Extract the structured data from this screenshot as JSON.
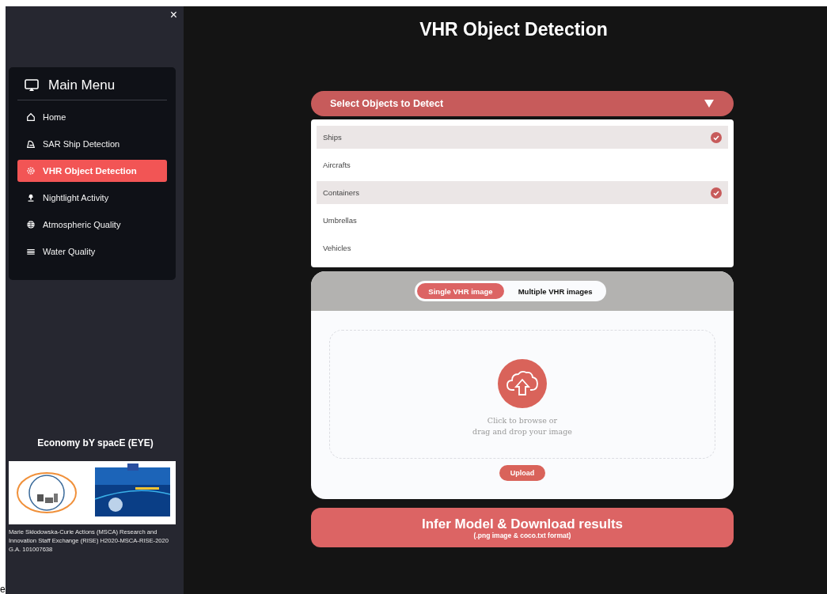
{
  "sidebar": {
    "close": "×",
    "menu_title": "Main Menu",
    "items": [
      {
        "label": "Home",
        "selected": false
      },
      {
        "label": "SAR Ship Detection",
        "selected": false
      },
      {
        "label": "VHR Object Detection",
        "selected": true
      },
      {
        "label": "Nightlight Activity",
        "selected": false
      },
      {
        "label": "Atmospheric Quality",
        "selected": false
      },
      {
        "label": "Water Quality",
        "selected": false
      }
    ],
    "project_title": "Economy bY spacE (EYE)",
    "caption": "Marie Skłodowska-Curie Actions (MSCA) Research and Innovation Staff Exchange (RISE) H2020-MSCA-RISE-2020 G.A. 101007638",
    "stray_text": "e"
  },
  "page_title": "VHR Object Detection",
  "object_select": {
    "label": "Select Objects to Detect",
    "expanded": true,
    "options": [
      {
        "label": "Ships",
        "selected": true
      },
      {
        "label": "Aircrafts",
        "selected": false
      },
      {
        "label": "Containers",
        "selected": true
      },
      {
        "label": "Umbrellas",
        "selected": false
      },
      {
        "label": "Vehicles",
        "selected": false
      }
    ]
  },
  "upload": {
    "tabs": [
      {
        "label": "Single VHR image",
        "selected": true
      },
      {
        "label": "Multiple VHR images",
        "selected": false
      }
    ],
    "hint": [
      "Click to browse or",
      "drag and drop your image"
    ],
    "button": "Upload"
  },
  "infer_button": {
    "label": "Infer Model & Download results",
    "sublabel": "(.png image & coco.txt format)"
  }
}
